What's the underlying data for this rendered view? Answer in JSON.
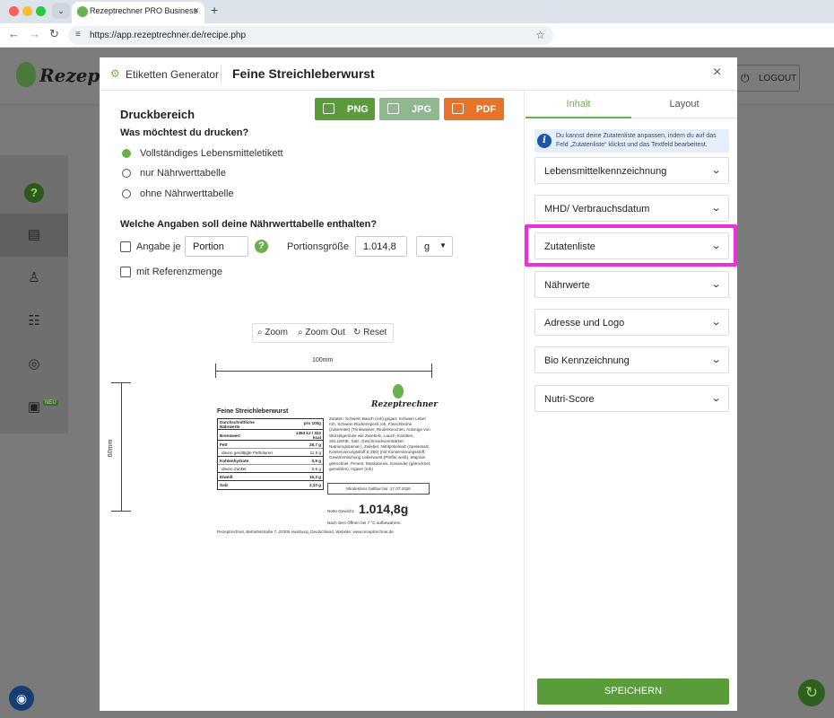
{
  "browser": {
    "tab_title": "Rezeptrechner PRO Business",
    "tab_close": "×",
    "new_tab": "+",
    "url": "https://app.rezeptrechner.de/recipe.php",
    "back": "←",
    "forward": "→",
    "reload": "↻",
    "star": "☆",
    "site_info": "≡",
    "dropdown": "⌄"
  },
  "app": {
    "brand": "Rezeptrechner",
    "logout": "LOGOUT",
    "sidebar": [
      {
        "icon": "help-icon",
        "glyph": "?"
      },
      {
        "icon": "recipe-icon",
        "glyph": "▤"
      },
      {
        "icon": "user-icon",
        "glyph": "♙"
      },
      {
        "icon": "checklist-icon",
        "glyph": "☷"
      },
      {
        "icon": "dish-icon",
        "glyph": "◎"
      },
      {
        "icon": "clipboard-icon",
        "glyph": "▣"
      }
    ],
    "new_badge": "NEU"
  },
  "modal": {
    "tool_name": "Etiketten Generator",
    "recipe_title": "Feine Streichleberwurst",
    "close": "×"
  },
  "print": {
    "title": "Druckbereich",
    "buttons": {
      "png": "PNG",
      "jpg": "JPG",
      "pdf": "PDF"
    },
    "question": "Was möchtest du drucken?",
    "options": [
      "Vollständiges Lebensmitteletikett",
      "nur Nährwerttabelle",
      "ohne Nährwerttabelle"
    ],
    "selected_option": 0,
    "nutrition_question": "Welche Angaben soll deine Nährwerttabelle enthalten?",
    "per_label": "Angabe je",
    "per_value": "Portion",
    "help": "?",
    "portion_label": "Portionsgröße",
    "portion_value": "1.014,8",
    "unit": "g",
    "reference_label": "mit Referenzmenge",
    "zoom_in": "Zoom",
    "zoom_out": "Zoom Out",
    "reset": "Reset"
  },
  "label": {
    "width": "100mm",
    "height": "60mm",
    "product": "Feine Streichleberwurst",
    "table": {
      "header_left": "Durchschnittliche Nährwerte",
      "header_right": "pro 100g",
      "rows": [
        {
          "k": "Brennwert",
          "v": "1354 kJ / 323 kcal"
        },
        {
          "k": "Fett",
          "v": "28,7 g"
        },
        {
          "k": "davon gesättigte Fettsäuren",
          "v": "11,5 g"
        },
        {
          "k": "Kohlenhydrate",
          "v": "0,9 g"
        },
        {
          "k": "davon Zucker",
          "v": "0,6 g"
        },
        {
          "k": "Eiweiß",
          "v": "16,3 g"
        },
        {
          "k": "Salz",
          "v": "2,10 g"
        }
      ]
    },
    "brand": "Rezeptrechner",
    "ingredients": "Zutaten: Schwein Bauch (roh) gegart, Schwein Leber roh, Schwein Rückenspeck roh, Fleischbrühe (zubereitet) (Trinkwasser, Rinderknochen, Auszüge von Wurzelgemüse wie Zwiebeln, Lauch, Karotten, SELLERIE, Salz, Geschmacksverstärker: Natriumglutamat ), Zwiebel, Nitritpökelsalz (Speisesalz, Konservierungsstoff E 250) (mit Konservierungsstoff, Gewürzmischung Leberwurst (Pfeffer weiß), Majoran getrocknet, Piment, Muskatnuss, Koriander (getrocknet, gemahlen), Ingwer (roh)",
    "mhd": "Mindestens haltbar bis: 17.07.2026",
    "netto_label": "Netto Gewicht:",
    "netto_value": "1.014,8g",
    "open_note": "Nach dem Öffnen bei 7 °C aufbewahren.",
    "address": "Rezeptrechner, Betriebsstraße 7, 22305 Hamburg, Deutschland, Website: www.rezeptrechner.de"
  },
  "panel": {
    "tab_content": "Inhalt",
    "tab_layout": "Layout",
    "info": "Du kannst deine Zutatenliste anpassen, indem du auf das Feld „Zutatenliste“ klickst und das Textfeld bearbeitest.",
    "sections": [
      "Lebensmittelkennzeichnung",
      "MHD/ Verbrauchsdatum",
      "Zutatenliste",
      "Nährwerte",
      "Adresse und Logo",
      "Bio Kennzeichnung",
      "Nutri-Score"
    ],
    "highlighted": "Zutatenliste",
    "save": "SPEICHERN"
  },
  "colors": {
    "brand_green": "#6ab04c",
    "png_button": "#5a9b3a",
    "jpg_button": "#8fb891",
    "pdf_button": "#e8742c",
    "highlight": "#ee2fd9",
    "info_bg": "#e5eefa"
  }
}
